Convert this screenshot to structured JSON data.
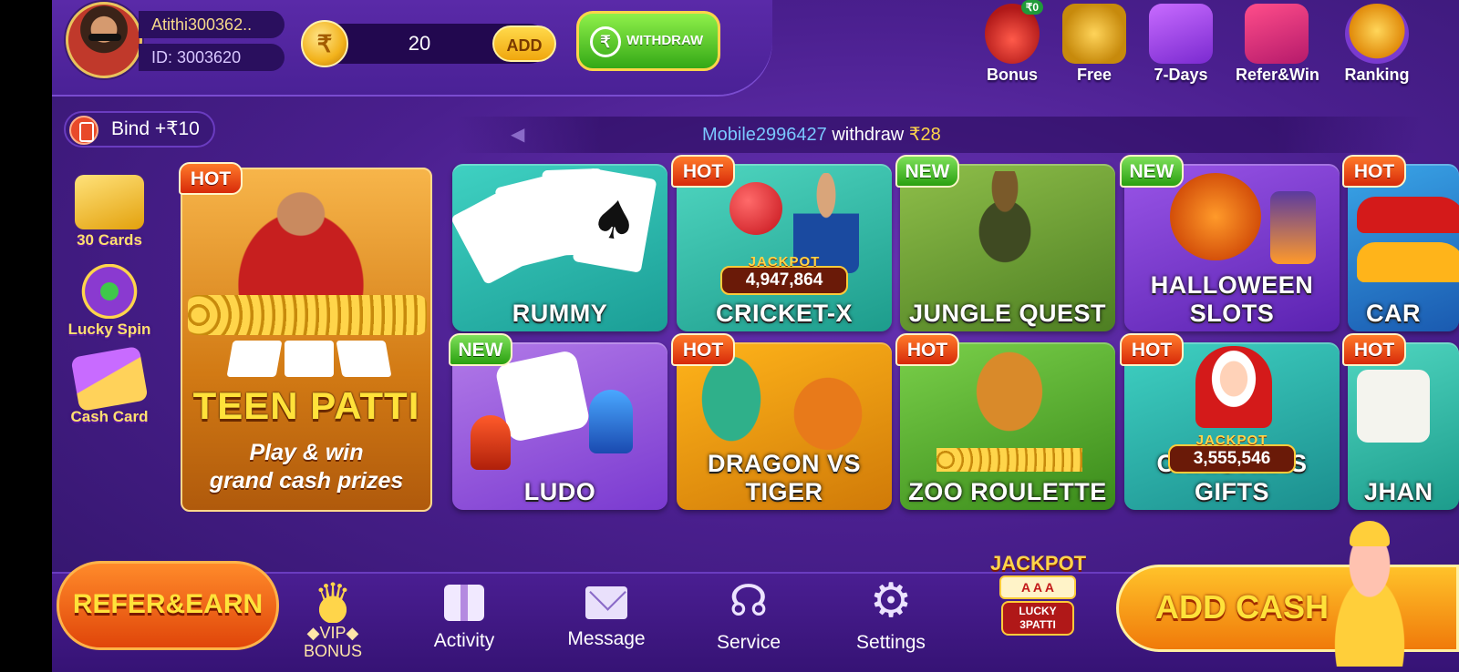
{
  "header": {
    "username": "Atithi300362..",
    "user_id": "ID: 3003620",
    "balance": "20",
    "currency_symbol": "₹",
    "add_label": "ADD",
    "withdraw_label": "WITHDRAW",
    "withdraw_icon_text": "₹",
    "top_icons": [
      {
        "label": "Bonus",
        "icon": "bonus-pot-icon",
        "badge": "₹0"
      },
      {
        "label": "Free",
        "icon": "coin-stack-icon"
      },
      {
        "label": "7-Days",
        "icon": "gift-box-icon"
      },
      {
        "label": "Refer&Win",
        "icon": "treasure-chest-icon"
      },
      {
        "label": "Ranking",
        "icon": "trophy-icon"
      }
    ]
  },
  "bind": {
    "label": "Bind +₹10"
  },
  "ticker": {
    "user": "Mobile2996427",
    "action": " withdraw ",
    "amount": "₹28"
  },
  "side_menu": [
    {
      "label": "30 Cards",
      "icon": "cards-icon"
    },
    {
      "label": "Lucky Spin",
      "icon": "spin-wheel-icon"
    },
    {
      "label": "Cash Card",
      "icon": "cash-card-icon"
    }
  ],
  "featured": {
    "badge": "HOT",
    "title": "TEEN PATTI",
    "subtitle_line1": "Play & win",
    "subtitle_line2": "grand cash prizes"
  },
  "games": [
    {
      "name": "RUMMY",
      "badge": "",
      "jackpot": ""
    },
    {
      "name": "CRICKET-X",
      "badge": "HOT",
      "jackpot": "4,947,864"
    },
    {
      "name": "JUNGLE QUEST",
      "badge": "NEW",
      "jackpot": ""
    },
    {
      "name": "HALLOWEEN  SLOTS",
      "badge": "NEW",
      "jackpot": ""
    },
    {
      "name": "CAR",
      "badge": "HOT",
      "jackpot": ""
    },
    {
      "name": "LUDO",
      "badge": "NEW",
      "jackpot": ""
    },
    {
      "name": "DRAGON VS TIGER",
      "badge": "HOT",
      "jackpot": ""
    },
    {
      "name": "ZOO ROULETTE",
      "badge": "HOT",
      "jackpot": ""
    },
    {
      "name": "CHRISTMAS GIFTS",
      "badge": "HOT",
      "jackpot": "3,555,546"
    },
    {
      "name": "JHAN",
      "badge": "HOT",
      "jackpot": ""
    }
  ],
  "bottom_nav": {
    "refer_earn": "REFER&EARN",
    "vip_top": "◆VIP◆",
    "vip_bottom": "BONUS",
    "activity": "Activity",
    "message": "Message",
    "service": "Service",
    "settings": "Settings",
    "lucky3_jackpot": "JACKPOT",
    "lucky3_cards": "A A A",
    "lucky3_name": "LUCKY 3PATTI",
    "add_cash": "ADD CASH"
  },
  "colors": {
    "background": "#4a1f8e",
    "accent_gold": "#ffd54a",
    "hot_badge": "#e0360a",
    "new_badge": "#3fb020",
    "withdraw_green": "#34a816"
  }
}
